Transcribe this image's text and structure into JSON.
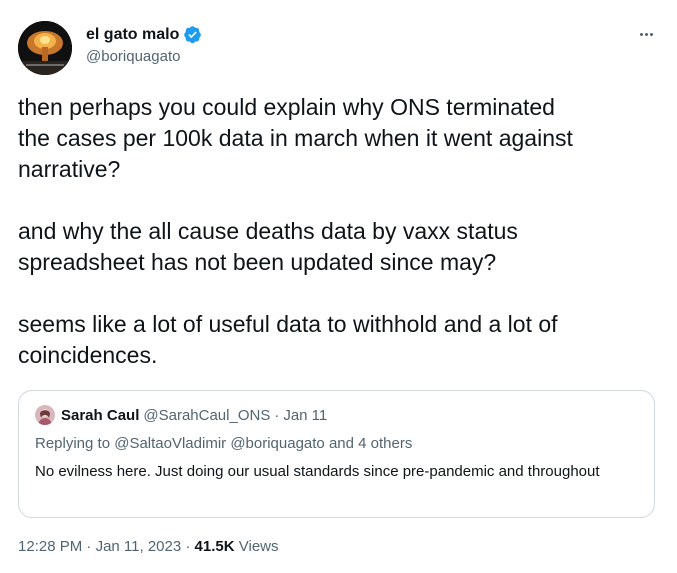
{
  "author": {
    "display_name": "el gato malo",
    "handle": "@boriquagato",
    "verified_icon": "verified-badge-icon",
    "verified_color": "#1d9bf0"
  },
  "tweet": {
    "paragraphs": [
      "then perhaps you could explain why ONS terminated\nthe cases per 100k data in march when it went against\nnarrative?",
      "and why the all cause deaths data by vaxx status\nspreadsheet has not been updated since may?",
      "seems like a lot of useful data to withhold and a lot of\ncoincidences."
    ]
  },
  "quote": {
    "display_name": "Sarah Caul",
    "handle": "@SarahCaul_ONS",
    "date": "Jan 11",
    "separator": "·",
    "replying_to": "Replying to @SaltaoVladimir @boriquagato and 4 others",
    "text": "No evilness here. Just doing our usual standards since pre-pandemic and throughout"
  },
  "footer": {
    "time": "12:28 PM",
    "date": "Jan 11, 2023",
    "views_count": "41.5K",
    "views_label": "Views",
    "separator": "·"
  },
  "more_icon": "more-options-icon",
  "colors": {
    "text_primary": "#0f1419",
    "text_secondary": "#536471",
    "border": "#cfd9de"
  }
}
